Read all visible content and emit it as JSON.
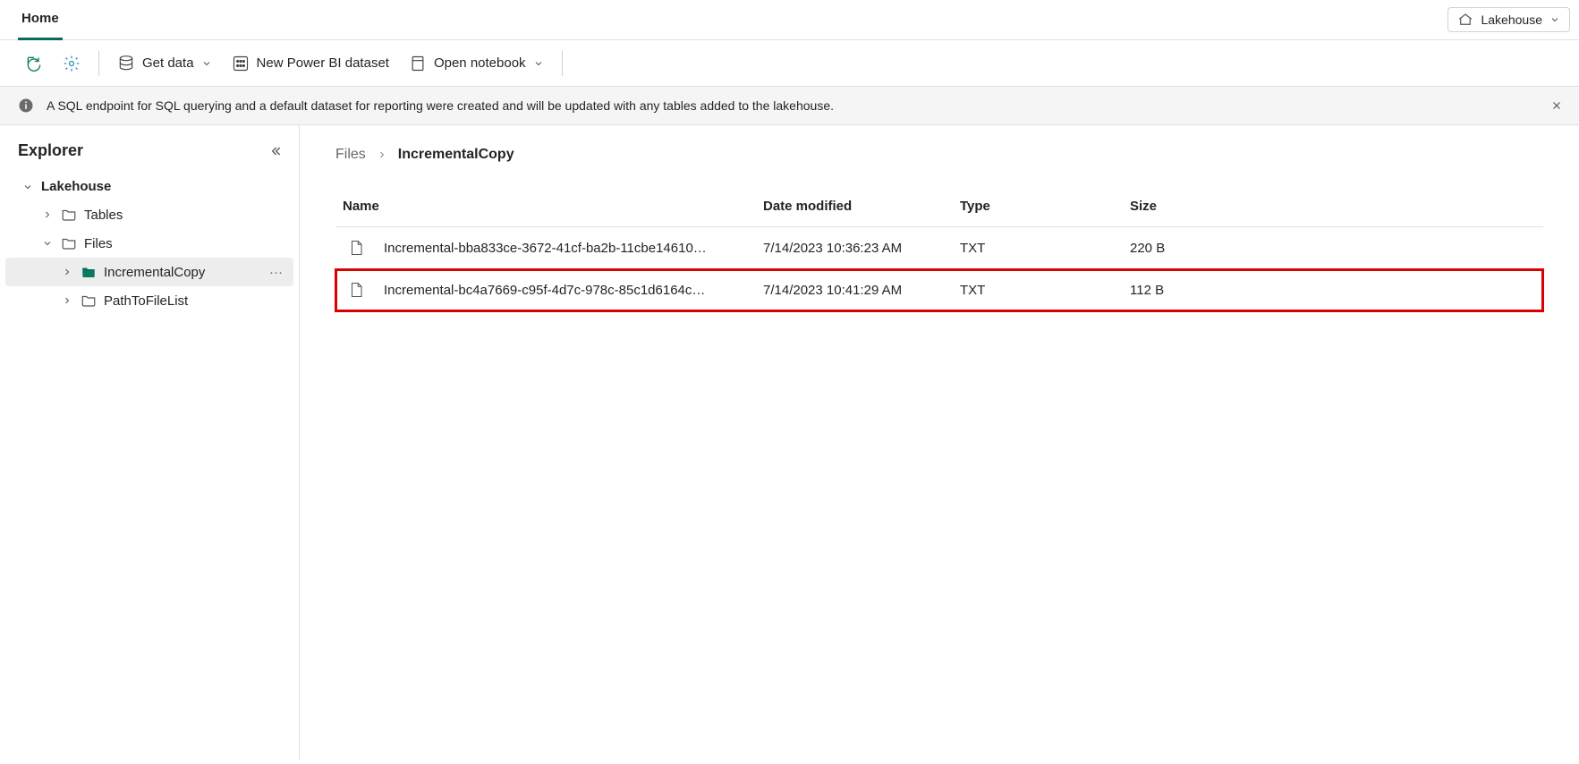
{
  "top": {
    "tab": "Home",
    "dropdown_label": "Lakehouse"
  },
  "toolbar": {
    "get_data": "Get data",
    "new_dataset": "New Power BI dataset",
    "open_notebook": "Open notebook"
  },
  "banner": {
    "text": "A SQL endpoint for SQL querying and a default dataset for reporting were created and will be updated with any tables added to the lakehouse."
  },
  "explorer": {
    "title": "Explorer",
    "root": "Lakehouse",
    "tables": "Tables",
    "files": "Files",
    "incremental_copy": "IncrementalCopy",
    "path_to_file_list": "PathToFileList"
  },
  "breadcrumb": {
    "parent": "Files",
    "current": "IncrementalCopy"
  },
  "table": {
    "headers": {
      "name": "Name",
      "date": "Date modified",
      "type": "Type",
      "size": "Size"
    },
    "rows": [
      {
        "name": "Incremental-bba833ce-3672-41cf-ba2b-11cbe14610…",
        "date": "7/14/2023 10:36:23 AM",
        "type": "TXT",
        "size": "220 B",
        "highlighted": false
      },
      {
        "name": "Incremental-bc4a7669-c95f-4d7c-978c-85c1d6164c…",
        "date": "7/14/2023 10:41:29 AM",
        "type": "TXT",
        "size": "112 B",
        "highlighted": true
      }
    ]
  }
}
